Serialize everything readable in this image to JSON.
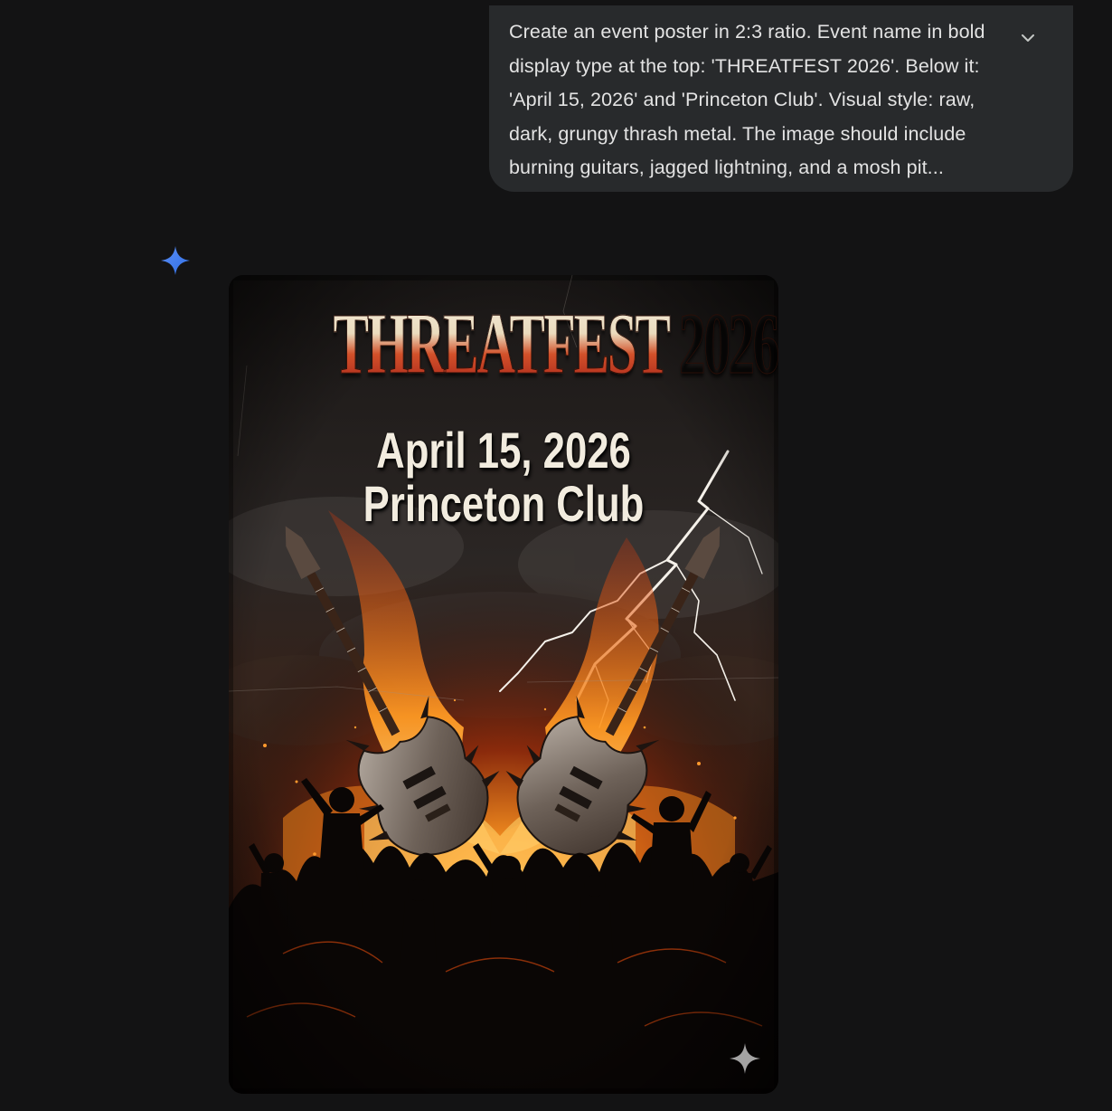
{
  "user_prompt": {
    "text": "Create an event poster in 2:3 ratio. Event name in bold\ndisplay type at the top: 'THREATFEST 2026'. Below it:\n'April 15, 2026' and 'Princeton Club'. Visual style: raw,\ndark, grungy thrash metal. The image should include\nburning guitars, jagged lightning, and a mosh pit..."
  },
  "icons": {
    "expand": "chevron-down-icon",
    "assistant": "sparkle-icon",
    "watermark": "sparkle-watermark-icon"
  },
  "poster": {
    "title": "THREATFEST 2026",
    "date": "April 15, 2026",
    "venue": "Princeton Club"
  },
  "colors": {
    "page_bg": "#131314",
    "bubble_bg": "#282a2c",
    "prompt_text": "#e3e3e3",
    "sparkle_blue": "#4285f4"
  }
}
